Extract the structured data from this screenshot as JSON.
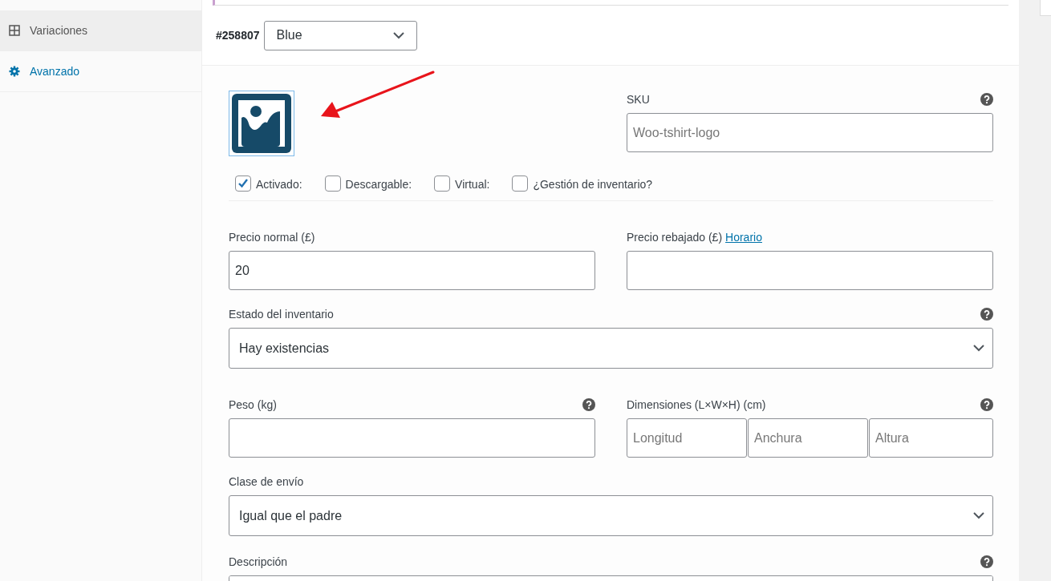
{
  "sidebar": {
    "items": [
      {
        "label": "Variaciones",
        "selected": true
      },
      {
        "label": "Avanzado",
        "selected": false
      }
    ]
  },
  "variation": {
    "id": "#258807",
    "attribute_value": "Blue"
  },
  "sku": {
    "label": "SKU",
    "placeholder": "Woo-tshirt-logo",
    "help": true
  },
  "options": [
    {
      "label": "Activado:",
      "checked": true
    },
    {
      "label": "Descargable:",
      "checked": false
    },
    {
      "label": "Virtual:",
      "checked": false
    },
    {
      "label": "¿Gestión de inventario?",
      "checked": false
    }
  ],
  "regular_price": {
    "label": "Precio normal (£)",
    "value": "20",
    "help": false
  },
  "sale_price": {
    "label": "Precio rebajado (£)",
    "link": "Horario",
    "help": false
  },
  "stock_status": {
    "label": "Estado del inventario",
    "value": "Hay existencias",
    "help": true
  },
  "weight": {
    "label": "Peso (kg)",
    "help": true
  },
  "dimensions": {
    "label": "Dimensiones (L×W×H) (cm)",
    "placeholders": [
      "Longitud",
      "Anchura",
      "Altura"
    ],
    "help": true
  },
  "shipping_class": {
    "label": "Clase de envío",
    "value": "Igual que el padre",
    "help": false
  },
  "description": {
    "label": "Descripción",
    "help": true
  }
}
